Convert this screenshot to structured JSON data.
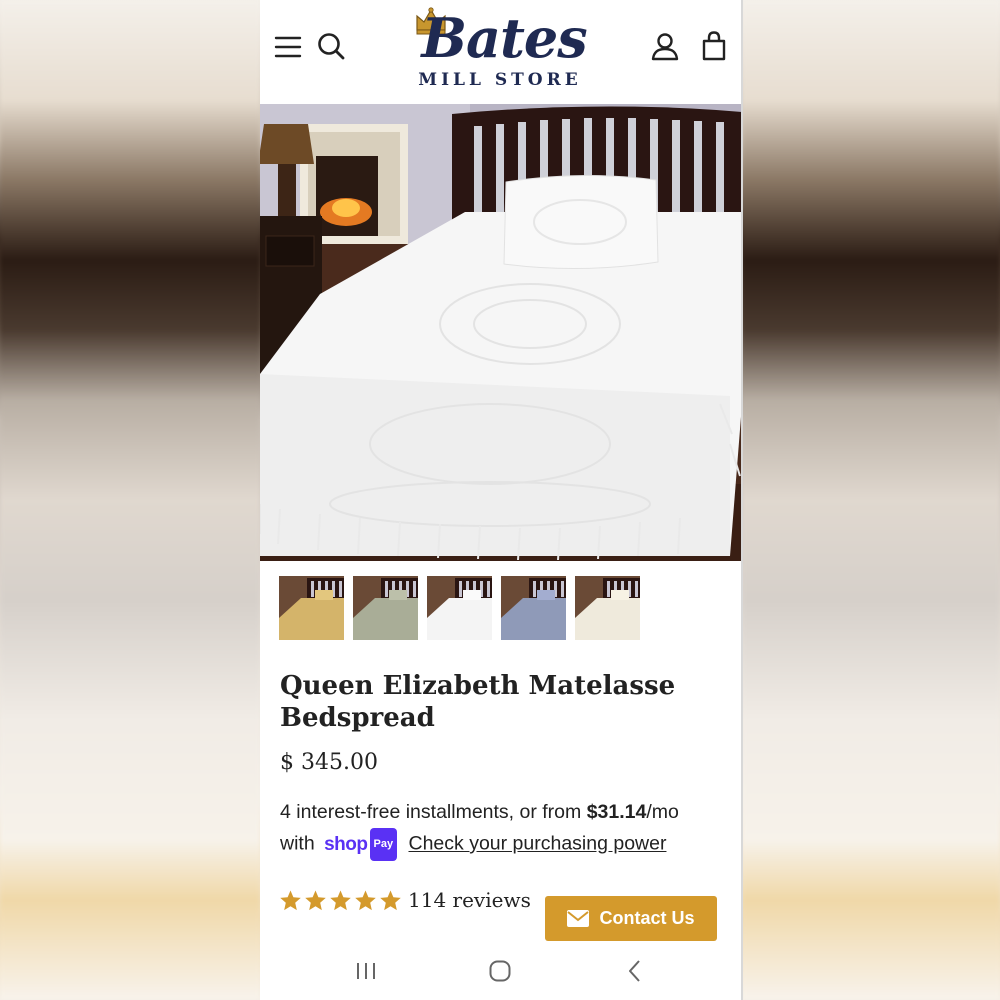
{
  "header": {
    "logo_script": "Bates",
    "logo_sub": "MILL STORE"
  },
  "product": {
    "title": "Queen Elizabeth Matelasse Bedspread",
    "price": "$ 345.00",
    "installments_prefix": "4 interest-free installments, or from ",
    "installment_amount": "$31.14",
    "installment_suffix": "/mo",
    "with_label": "with",
    "shoppay_word": "shop",
    "shoppay_badge": "Pay",
    "purchasing_power_link": "Check your purchasing power",
    "rating_stars": 5,
    "reviews_label": "114 reviews",
    "thumbnail_colors": [
      "gold",
      "sage",
      "white",
      "blue",
      "ivory"
    ]
  },
  "contact": {
    "label": "Contact Us"
  },
  "colors": {
    "brand_navy": "#1f2a52",
    "accent_gold": "#d49a2c",
    "shoppay_purple": "#5a31f4"
  },
  "icons": {
    "menu": "menu-icon",
    "search": "search-icon",
    "account": "account-icon",
    "cart": "cart-icon",
    "mail": "mail-icon",
    "star": "star-icon"
  }
}
